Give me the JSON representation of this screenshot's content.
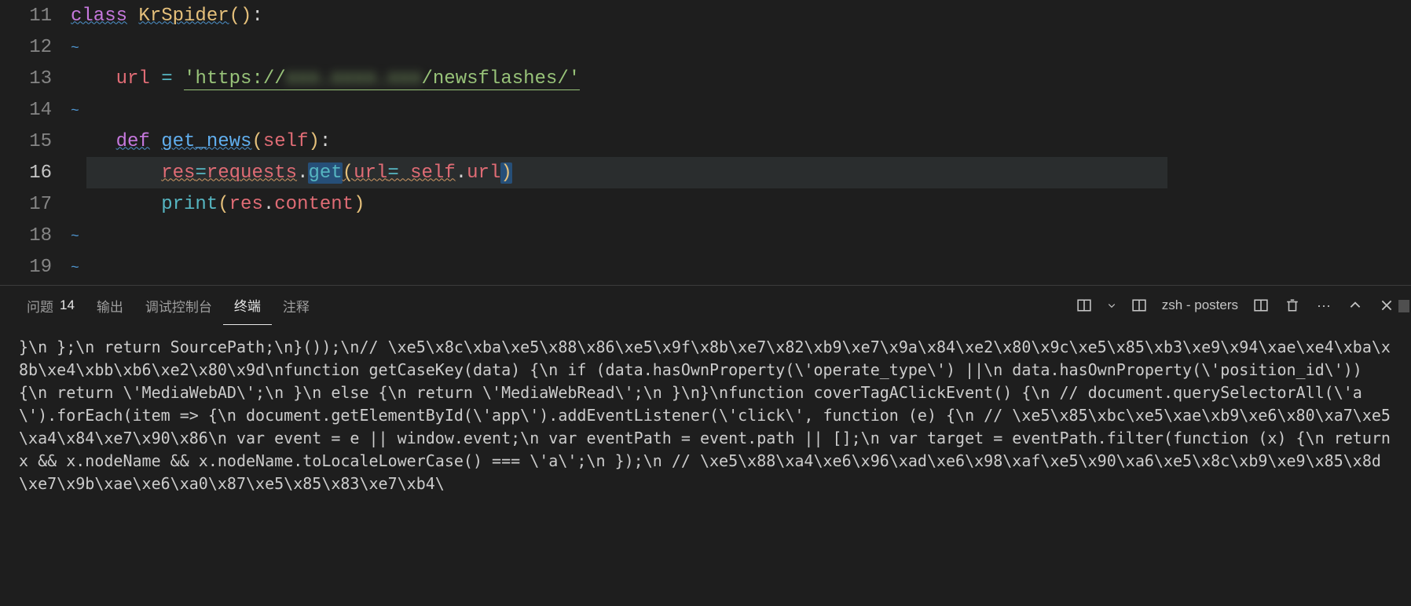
{
  "editor": {
    "lines": [
      {
        "num": 11,
        "active": false
      },
      {
        "num": 12,
        "active": false
      },
      {
        "num": 13,
        "active": false
      },
      {
        "num": 14,
        "active": false
      },
      {
        "num": 15,
        "active": false
      },
      {
        "num": 16,
        "active": true
      },
      {
        "num": 17,
        "active": false
      },
      {
        "num": 18,
        "active": false
      },
      {
        "num": 19,
        "active": false
      }
    ],
    "code": {
      "class_kw": "class",
      "class_name": "KrSpider",
      "url_var": "url",
      "url_prefix": "'https://",
      "url_host_blurred": "xxx.xxxx.xxx",
      "url_suffix": "/newsflashes/'",
      "def_kw": "def",
      "fn_name": "get_news",
      "self": "self",
      "res": "res",
      "requests": "requests",
      "get": "get",
      "url_kw": "url",
      "print": "print",
      "content": "content"
    }
  },
  "panel": {
    "tabs": {
      "problems": "问题",
      "problems_count": "14",
      "output": "输出",
      "debug_console": "调试控制台",
      "terminal": "终端",
      "comments": "注释"
    },
    "shell_label": "zsh - posters"
  },
  "terminal_output": " }\\n    };\\n    return SourcePath;\\n}());\\n// \\xe5\\x8c\\xba\\xe5\\x88\\x86\\xe5\\x9f\\x8b\\xe7\\x82\\xb9\\xe7\\x9a\\x84\\xe2\\x80\\x9c\\xe5\\x85\\xb3\\xe9\\x94\\xae\\xe4\\xba\\x8b\\xe4\\xbb\\xb6\\xe2\\x80\\x9d\\nfunction getCaseKey(data) {\\n    if (data.hasOwnProperty(\\'operate_type\\') ||\\n        data.hasOwnProperty(\\'position_id\\')) {\\n        return \\'MediaWebAD\\';\\n    }\\n    else {\\n        return \\'MediaWebRead\\';\\n    }\\n}\\nfunction coverTagAClickEvent() {\\n    // document.querySelectorAll(\\'a\\').forEach(item => {\\n    document.getElementById(\\'app\\').addEventListener(\\'click\\', function (e) {\\n        // \\xe5\\x85\\xbc\\xe5\\xae\\xb9\\xe6\\x80\\xa7\\xe5\\xa4\\x84\\xe7\\x90\\x86\\n        var event = e || window.event;\\n        var eventPath = event.path || [];\\n        var target = eventPath.filter(function (x) {\\n            return x && x.nodeName && x.nodeName.toLocaleLowerCase() === \\'a\\';\\n        });\\n        // \\xe5\\x88\\xa4\\xe6\\x96\\xad\\xe6\\x98\\xaf\\xe5\\x90\\xa6\\xe5\\x8c\\xb9\\xe9\\x85\\x8d\\xe7\\x9b\\xae\\xe6\\xa0\\x87\\xe5\\x85\\x83\\xe7\\xb4\\"
}
